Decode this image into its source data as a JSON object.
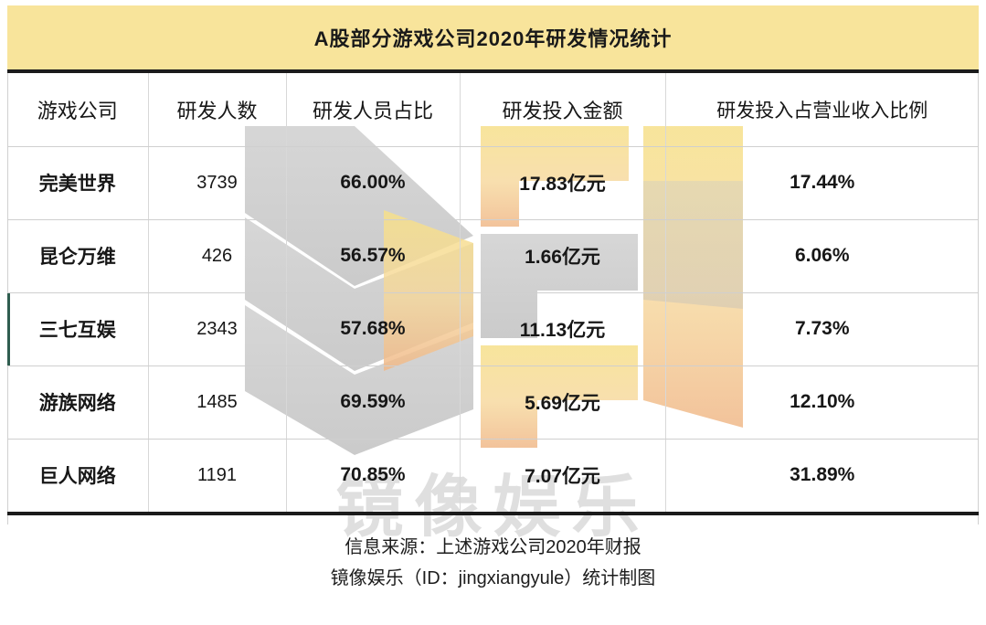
{
  "title": "A股部分游戏公司2020年研发情况统计",
  "table": {
    "headers": [
      "游戏公司",
      "研发人数",
      "研发人员占比",
      "研发投入金额",
      "研发投入占营业收入比例"
    ],
    "rows": [
      {
        "company": "完美世界",
        "rd_people": "3739",
        "rd_people_ratio": "66.00%",
        "rd_amount": "17.83亿元",
        "rd_revenue_ratio": "17.44%"
      },
      {
        "company": "昆仑万维",
        "rd_people": "426",
        "rd_people_ratio": "56.57%",
        "rd_amount": "1.66亿元",
        "rd_revenue_ratio": "6.06%"
      },
      {
        "company": "三七互娱",
        "rd_people": "2343",
        "rd_people_ratio": "57.68%",
        "rd_amount": "11.13亿元",
        "rd_revenue_ratio": "7.73%"
      },
      {
        "company": "游族网络",
        "rd_people": "1485",
        "rd_people_ratio": "69.59%",
        "rd_amount": "5.69亿元",
        "rd_revenue_ratio": "12.10%"
      },
      {
        "company": "巨人网络",
        "rd_people": "1191",
        "rd_people_ratio": "70.85%",
        "rd_amount": "7.07亿元",
        "rd_revenue_ratio": "31.89%"
      }
    ]
  },
  "footer": {
    "source_line": "信息来源：上述游戏公司2020年财报",
    "credit_line": "镜像娱乐（ID：jingxiangyule）统计制图"
  },
  "watermark": {
    "text": "镜像娱乐",
    "logo_name": "jingxiang-chevron-logo"
  },
  "colors": {
    "title_bg": "#F8E49B",
    "rule": "#1b1b1b",
    "grid_line": "#d8d8d8",
    "accent_row_marker": "#2f5d4f",
    "watermark_grey": "#969696",
    "watermark_yellow": "#F2D06B"
  },
  "chart_data": {
    "type": "table",
    "title": "A股部分游戏公司2020年研发情况统计",
    "columns": [
      "游戏公司",
      "研发人数",
      "研发人员占比",
      "研发投入金额",
      "研发投入占营业收入比例"
    ],
    "categories": [
      "完美世界",
      "昆仑万维",
      "三七互娱",
      "游族网络",
      "巨人网络"
    ],
    "series": [
      {
        "name": "研发人数",
        "unit": "人",
        "values": [
          3739,
          426,
          2343,
          1485,
          1191
        ]
      },
      {
        "name": "研发人员占比",
        "unit": "%",
        "values": [
          66.0,
          56.57,
          57.68,
          69.59,
          70.85
        ]
      },
      {
        "name": "研发投入金额",
        "unit": "亿元",
        "values": [
          17.83,
          1.66,
          11.13,
          5.69,
          7.07
        ]
      },
      {
        "name": "研发投入占营业收入比例",
        "unit": "%",
        "values": [
          17.44,
          6.06,
          7.73,
          12.1,
          31.89
        ]
      }
    ],
    "source": "信息来源：上述游戏公司2020年财报",
    "credit": "镜像娱乐（ID：jingxiangyule）统计制图"
  }
}
